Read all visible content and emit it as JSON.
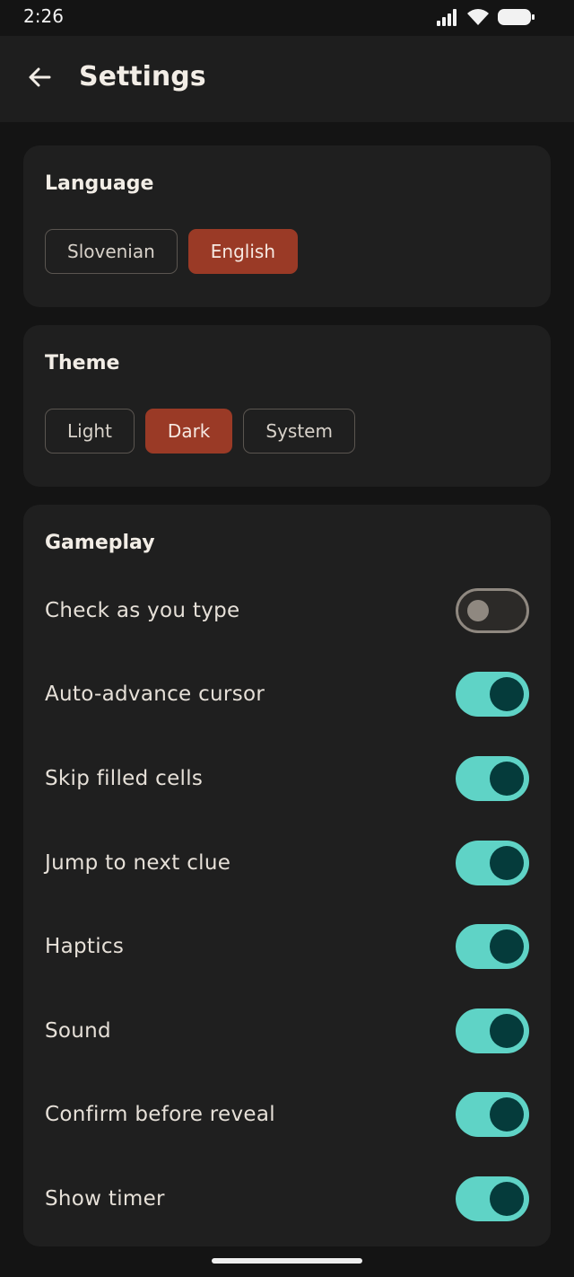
{
  "status_bar": {
    "time": "2:26"
  },
  "header": {
    "title": "Settings"
  },
  "language": {
    "title": "Language",
    "options": [
      "Slovenian",
      "English"
    ],
    "selected": "English"
  },
  "theme": {
    "title": "Theme",
    "options": [
      "Light",
      "Dark",
      "System"
    ],
    "selected": "Dark"
  },
  "gameplay": {
    "title": "Gameplay",
    "settings": [
      {
        "label": "Check as you type",
        "enabled": false
      },
      {
        "label": "Auto-advance cursor",
        "enabled": true
      },
      {
        "label": "Skip filled cells",
        "enabled": true
      },
      {
        "label": "Jump to next clue",
        "enabled": true
      },
      {
        "label": "Haptics",
        "enabled": true
      },
      {
        "label": "Sound",
        "enabled": true
      },
      {
        "label": "Confirm before reveal",
        "enabled": true
      },
      {
        "label": "Show timer",
        "enabled": true
      }
    ]
  },
  "colors": {
    "accent_selected": "#9a3a26",
    "toggle_on": "#5fd3c6",
    "toggle_knob_on": "#053b3b"
  }
}
